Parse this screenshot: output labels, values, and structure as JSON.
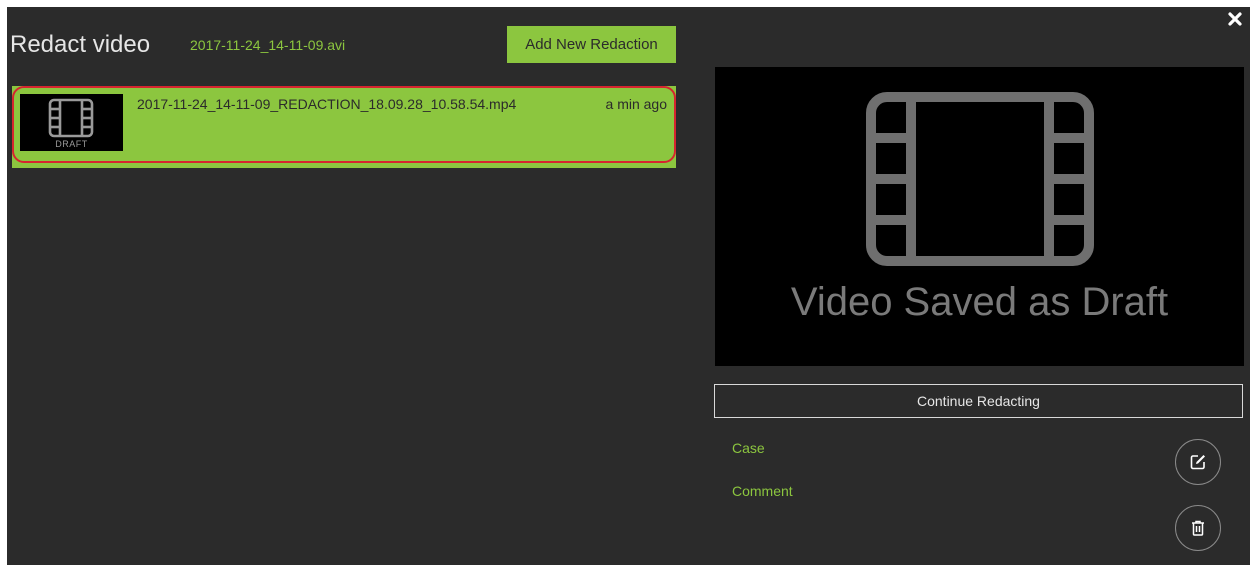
{
  "header": {
    "title": "Redact video",
    "source_file": "2017-11-24_14-11-09.avi",
    "add_button_label": "Add New Redaction"
  },
  "redactions": [
    {
      "file_name": "2017-11-24_14-11-09_REDACTION_18.09.28_10.58.54.mp4",
      "time_ago": "a min ago",
      "badge": "DRAFT",
      "thumbnail_icon": "film-icon"
    }
  ],
  "preview": {
    "icon": "film-icon",
    "status_text": "Video Saved as Draft"
  },
  "actions": {
    "continue_label": "Continue Redacting",
    "edit_icon": "edit-icon",
    "delete_icon": "trash-icon",
    "close_icon": "close-icon"
  },
  "fields": {
    "case_label": "Case",
    "comment_label": "Comment"
  },
  "colors": {
    "accent": "#8cc63f",
    "background": "#2b2b2b",
    "selection_ring": "#d6252f"
  }
}
